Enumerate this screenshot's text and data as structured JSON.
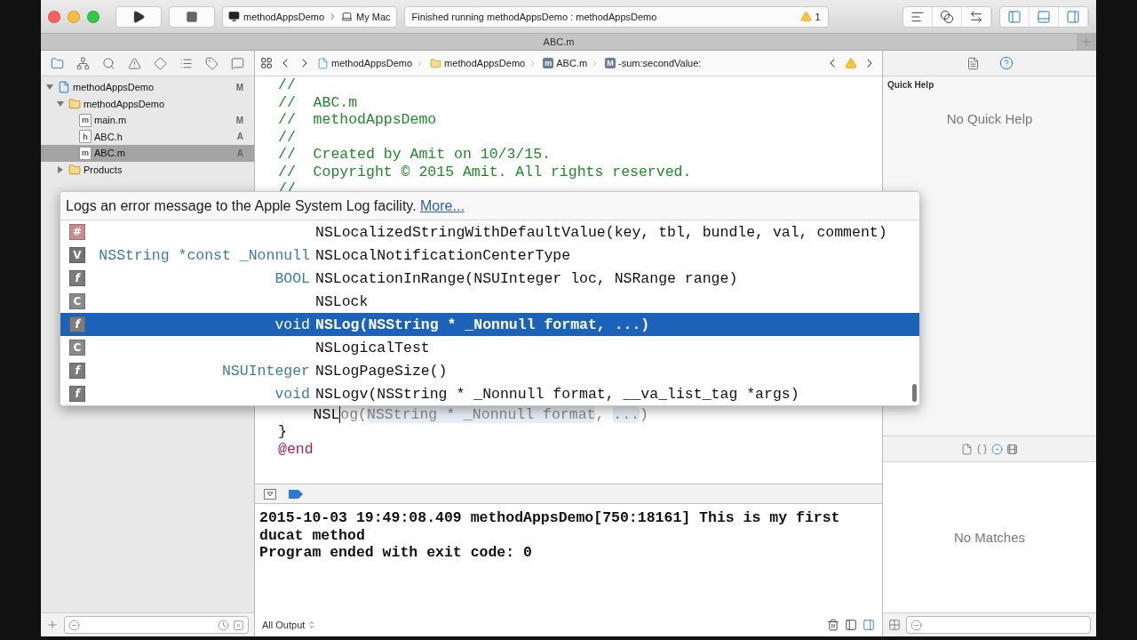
{
  "window": {
    "tab_title": "ABC.m"
  },
  "toolbar": {
    "scheme": "methodAppsDemo",
    "destination": "My Mac",
    "status": "Finished running methodAppsDemo : methodAppsDemo",
    "warning_count": "1"
  },
  "navigator": {
    "tree": [
      {
        "name": "methodAppsDemo",
        "kind": "project",
        "status": "M",
        "expanded": true,
        "selected": false,
        "children": [
          {
            "name": "methodAppsDemo",
            "kind": "folder",
            "expanded": true,
            "selected": false,
            "children": [
              {
                "name": "main.m",
                "kind": "file",
                "badge": "m",
                "status": "M",
                "selected": false
              },
              {
                "name": "ABC.h",
                "kind": "file",
                "badge": "h",
                "status": "A",
                "selected": false
              },
              {
                "name": "ABC.m",
                "kind": "file",
                "badge": "m",
                "status": "A",
                "selected": true
              }
            ]
          },
          {
            "name": "Products",
            "kind": "folder",
            "expanded": false,
            "selected": false
          }
        ]
      }
    ]
  },
  "jump_bar": {
    "path": [
      {
        "label": "methodAppsDemo",
        "kind": "project"
      },
      {
        "label": "methodAppsDemo",
        "kind": "folder"
      },
      {
        "label": "ABC.m",
        "kind": "file",
        "badge": "m"
      },
      {
        "label": "-sum:secondValue:",
        "kind": "method",
        "badge": "M"
      }
    ]
  },
  "editor": {
    "top_lines": [
      {
        "text": "//",
        "kind": "comment"
      },
      {
        "text": "//  ABC.m",
        "kind": "comment"
      },
      {
        "text": "//  methodAppsDemo",
        "kind": "comment"
      },
      {
        "text": "//",
        "kind": "comment"
      },
      {
        "text": "//  Created by Amit on 10/3/15.",
        "kind": "comment"
      },
      {
        "text": "//  Copyright © 2015 Amit. All rights reserved.",
        "kind": "comment"
      },
      {
        "text": "//",
        "kind": "comment"
      }
    ],
    "completion_line": {
      "typed": "NSL",
      "parts": [
        {
          "text": "og(",
          "kind": "plain"
        },
        {
          "text": "NSString * _Nonnull format",
          "kind": "token"
        },
        {
          "text": ", ",
          "kind": "plain"
        },
        {
          "text": "...",
          "kind": "token"
        },
        {
          "text": ")",
          "kind": "plain"
        }
      ]
    },
    "bottom_lines": [
      {
        "text": "}",
        "kind": "plain"
      },
      {
        "text": "@end",
        "kind": "keyword"
      }
    ]
  },
  "completion_popup": {
    "description": "Logs an error message to the Apple System Log facility.",
    "link": "More...",
    "items": [
      {
        "badge": "#",
        "kind": "macro",
        "name": "NSLocalizedStringWithDefaultValue(key, tbl, bundle, val, comment)",
        "selected": false
      },
      {
        "badge": "V",
        "kind": "variable",
        "type": "NSString *const _Nonnull",
        "name": "NSLocalNotificationCenterType",
        "selected": false
      },
      {
        "badge": "f",
        "kind": "function",
        "type": "BOOL",
        "name": "NSLocationInRange(NSUInteger loc, NSRange range)",
        "selected": false
      },
      {
        "badge": "C",
        "kind": "class",
        "name": "NSLock",
        "selected": false
      },
      {
        "badge": "f",
        "kind": "function",
        "type": "void",
        "name": "NSLog(NSString * _Nonnull format, ...)",
        "selected": true
      },
      {
        "badge": "C",
        "kind": "class",
        "name": "NSLogicalTest",
        "selected": false
      },
      {
        "badge": "f",
        "kind": "function",
        "type": "NSUInteger",
        "name": "NSLogPageSize()",
        "selected": false
      },
      {
        "badge": "f",
        "kind": "function",
        "type": "void",
        "name": "NSLogv(NSString * _Nonnull format, __va_list_tag *args)",
        "selected": false
      }
    ]
  },
  "console": {
    "lines": [
      "2015-10-03 19:49:08.409 methodAppsDemo[750:18161] This is my first ducat method",
      "Program ended with exit code: 0"
    ],
    "output_filter": "All Output"
  },
  "utilities": {
    "quick_help": {
      "title": "Quick Help",
      "message": "No Quick Help"
    },
    "library": {
      "message": "No Matches"
    }
  }
}
